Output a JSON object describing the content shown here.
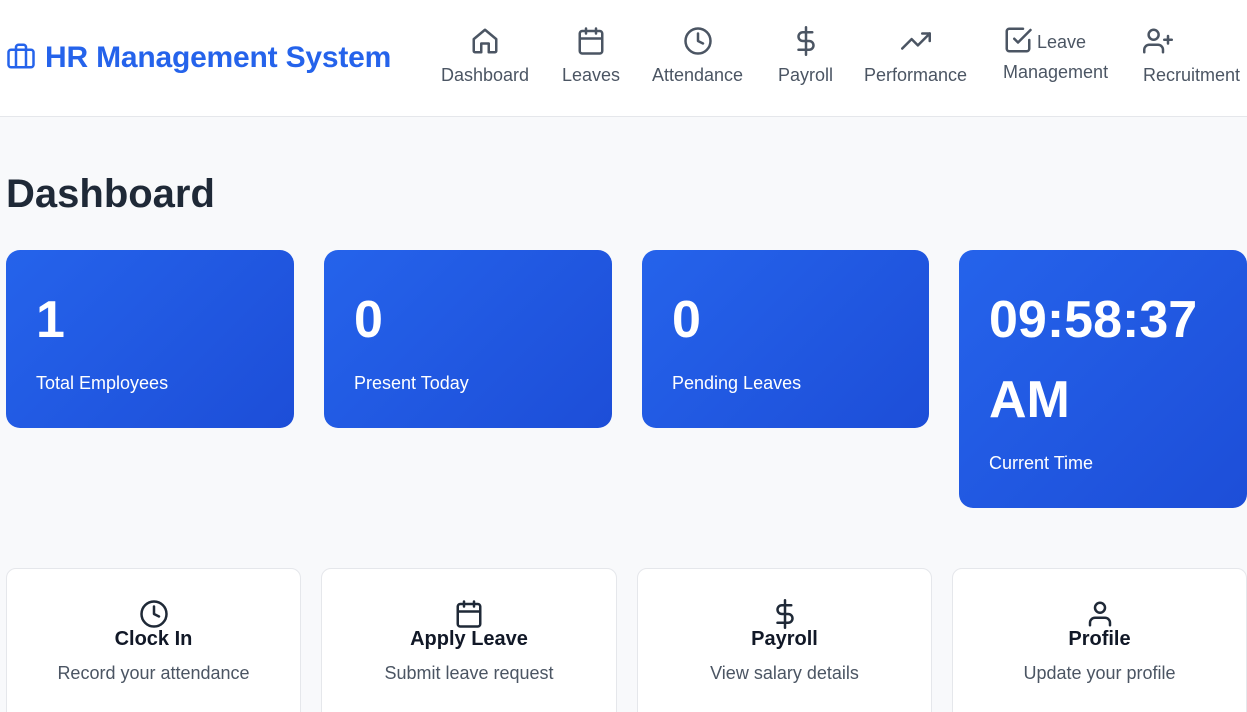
{
  "app": {
    "title": "HR Management System",
    "brand_icon": "briefcase-icon",
    "accent_color": "#2563eb"
  },
  "nav": {
    "items": [
      {
        "label": "Dashboard",
        "icon": "home-icon"
      },
      {
        "label": "Leaves",
        "icon": "calendar-icon"
      },
      {
        "label": "Attendance",
        "icon": "clock-icon"
      },
      {
        "label": "Payroll",
        "icon": "dollar-icon"
      },
      {
        "label": "Performance",
        "icon": "trending-up-icon"
      },
      {
        "label_line1": "Leave",
        "label_line2": "Management",
        "icon": "check-square-icon"
      },
      {
        "label": "Recruitment",
        "icon": "user-plus-icon"
      }
    ]
  },
  "page": {
    "title": "Dashboard"
  },
  "stats": [
    {
      "value": "1",
      "label": "Total Employees"
    },
    {
      "value": "0",
      "label": "Present Today"
    },
    {
      "value": "0",
      "label": "Pending Leaves"
    },
    {
      "value_line1": "09:58:37",
      "value_line2": "AM",
      "label": "Current Time"
    }
  ],
  "actions": [
    {
      "title": "Clock In",
      "desc": "Record your attendance",
      "icon": "clock-icon"
    },
    {
      "title": "Apply Leave",
      "desc": "Submit leave request",
      "icon": "calendar-icon"
    },
    {
      "title": "Payroll",
      "desc": "View salary details",
      "icon": "dollar-icon"
    },
    {
      "title": "Profile",
      "desc": "Update your profile",
      "icon": "user-icon"
    }
  ]
}
